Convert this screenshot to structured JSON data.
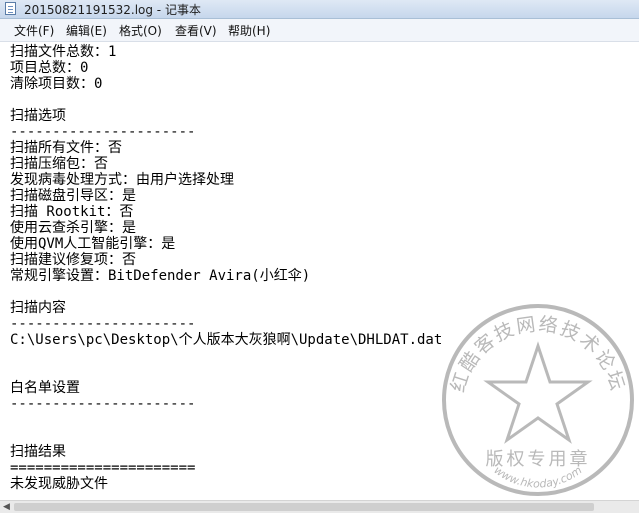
{
  "window": {
    "title": "20150821191532.log - 记事本"
  },
  "menu": {
    "file": "文件(F)",
    "edit": "编辑(E)",
    "format": "格式(O)",
    "view": "查看(V)",
    "help": "帮助(H)"
  },
  "content": {
    "lines": [
      "扫描文件总数：1",
      "项目总数：0",
      "清除项目数：0",
      "",
      "扫描选项",
      "----------------------",
      "扫描所有文件：否",
      "扫描压缩包：否",
      "发现病毒处理方式：由用户选择处理",
      "扫描磁盘引导区：是",
      "扫描 Rootkit：否",
      "使用云查杀引擎：是",
      "使用QVM人工智能引擎：是",
      "扫描建议修复项：否",
      "常规引擎设置：BitDefender Avira(小红伞)",
      "",
      "扫描内容",
      "----------------------",
      "C:\\Users\\pc\\Desktop\\个人版本大灰狼啊\\Update\\DHLDAT.dat",
      "",
      "",
      "白名单设置",
      "----------------------",
      "",
      "",
      "扫描结果",
      "======================",
      "未发现威胁文件"
    ]
  },
  "stamp": {
    "arc_text": "红酷客技网络技术论坛",
    "center_text": "版权专用章",
    "url_text": "www.hkoday.com",
    "color": "#b9b9b9"
  }
}
